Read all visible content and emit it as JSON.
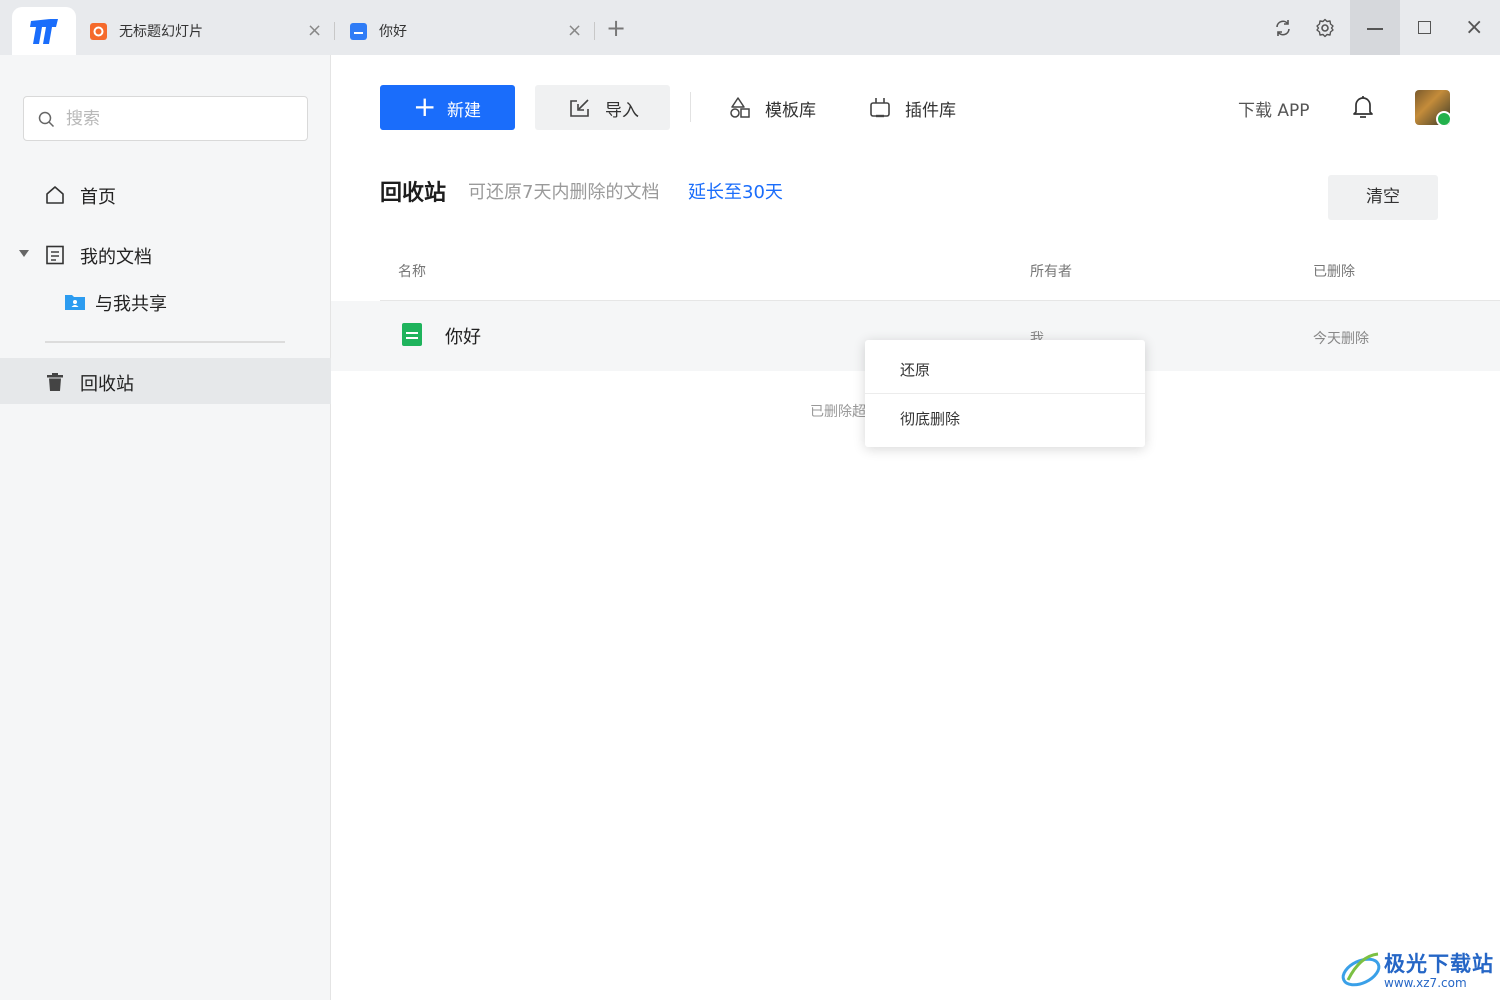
{
  "titlebar": {
    "tabs": [
      {
        "label": "无标题幻灯片",
        "icon": "slides-icon",
        "color": "#f56a2c"
      },
      {
        "label": "你好",
        "icon": "doc-icon",
        "color": "#2f7cf6"
      }
    ],
    "close_glyph": "×",
    "add_glyph": "+",
    "window_close_glyph": "×"
  },
  "sidebar": {
    "search_placeholder": "搜索",
    "items": [
      {
        "label": "首页",
        "icon": "home-icon"
      },
      {
        "label": "我的文档",
        "icon": "document-icon"
      },
      {
        "label": "与我共享",
        "icon": "shared-folder-icon"
      },
      {
        "label": "回收站",
        "icon": "trash-icon",
        "active": true
      }
    ]
  },
  "toolbar": {
    "new_label": "新建",
    "import_label": "导入",
    "templates_label": "模板库",
    "plugins_label": "插件库",
    "download_app_label": "下载 APP",
    "accent": "#1a6dfb"
  },
  "page": {
    "title": "回收站",
    "hint": "可还原7天内删除的文档",
    "extend_link": "延长至30天",
    "clear_label": "清空"
  },
  "table": {
    "headers": {
      "name": "名称",
      "owner": "所有者",
      "deleted": "已删除"
    },
    "rows": [
      {
        "name": "你好",
        "owner": "我",
        "deleted": "今天删除",
        "icon": "sheet-icon"
      }
    ],
    "footnote": "已删除超过"
  },
  "context_menu": {
    "items": [
      "还原",
      "彻底删除"
    ]
  },
  "watermark": {
    "text": "极光下载站",
    "url": "www.xz7.com"
  }
}
